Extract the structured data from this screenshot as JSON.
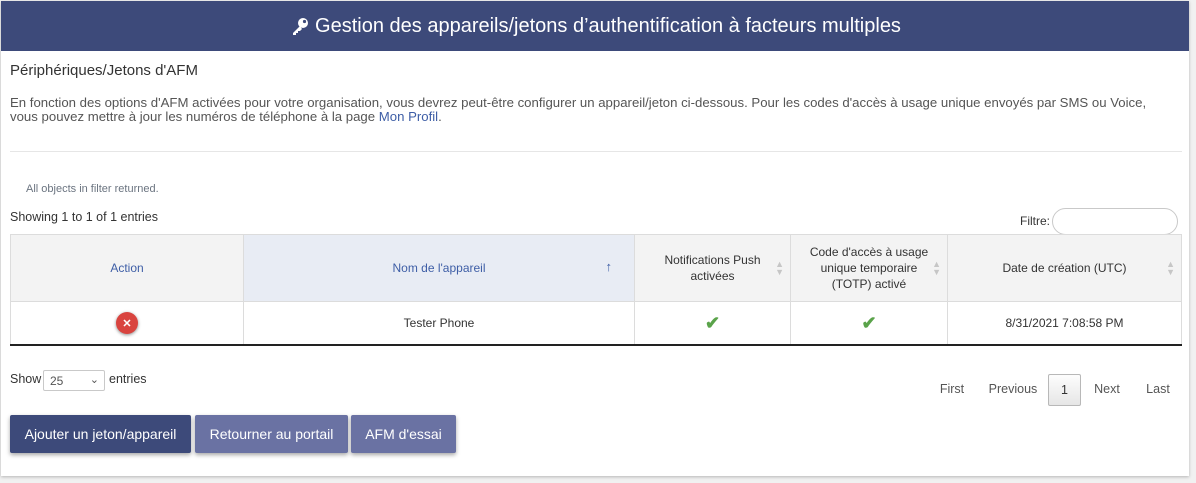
{
  "header": {
    "title": "Gestion des appareils/jetons d’authentification à facteurs multiples",
    "icon": "key-icon"
  },
  "subtitle": "Périphériques/Jetons d'AFM",
  "description": {
    "text": "En fonction des options d'AFM activées pour votre organisation, vous devrez peut-être configurer un appareil/jeton ci-dessous. Pour les codes d'accès à usage unique envoyés par SMS ou Voice, vous pouvez mettre à jour les numéros de téléphone à la page ",
    "link": "Mon Profil",
    "end": "."
  },
  "filter_message": "All objects in filter returned.",
  "showing": "Showing 1 to 1 of 1 entries",
  "filter_label": "Filtre:",
  "table": {
    "headers": [
      "Action",
      "Nom de l'appareil",
      "Notifications Push activées",
      "Code d'accès à usage unique temporaire (TOTP) activé",
      "Date de création (UTC)"
    ],
    "rows": [
      {
        "device": "Tester Phone",
        "push": "✔",
        "totp": "✔",
        "created": "8/31/2021 7:08:58 PM"
      }
    ]
  },
  "length": {
    "show": "Show",
    "value": "25",
    "entries": "entries"
  },
  "pagination": {
    "first": "First",
    "previous": "Previous",
    "current": "1",
    "next": "Next",
    "last": "Last"
  },
  "buttons": {
    "add": "Ajouter un jeton/appareil",
    "back": "Retourner au portail",
    "test": "AFM d'essai"
  },
  "colors": {
    "header": "#3d4a7a",
    "link": "#3e5ea6",
    "delete": "#d9443f",
    "check": "#5aa34a"
  }
}
